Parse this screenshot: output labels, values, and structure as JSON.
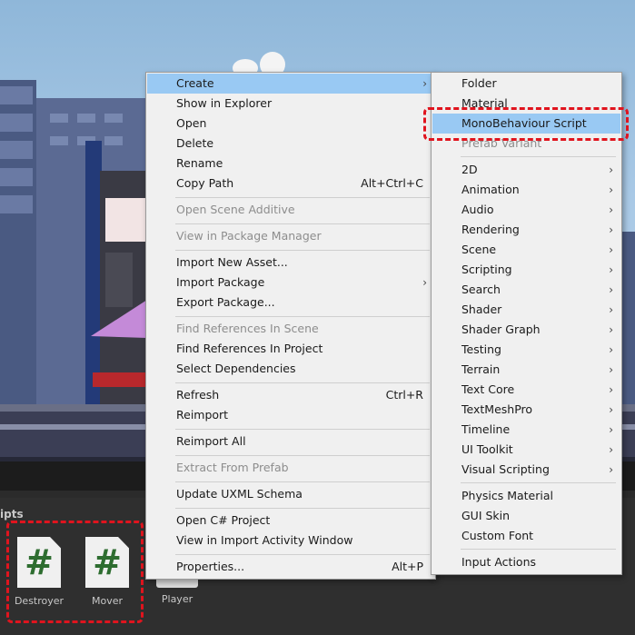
{
  "context_menu": {
    "items": [
      {
        "label": "Create",
        "shortcut": "",
        "submenu": true,
        "disabled": false,
        "highlighted": true
      },
      {
        "label": "Show in Explorer",
        "shortcut": "",
        "submenu": false,
        "disabled": false
      },
      {
        "label": "Open",
        "shortcut": "",
        "submenu": false,
        "disabled": false
      },
      {
        "label": "Delete",
        "shortcut": "",
        "submenu": false,
        "disabled": false
      },
      {
        "label": "Rename",
        "shortcut": "",
        "submenu": false,
        "disabled": false
      },
      {
        "label": "Copy Path",
        "shortcut": "Alt+Ctrl+C",
        "submenu": false,
        "disabled": false
      },
      {
        "label": "Open Scene Additive",
        "shortcut": "",
        "submenu": false,
        "disabled": true
      },
      {
        "label": "View in Package Manager",
        "shortcut": "",
        "submenu": false,
        "disabled": true
      },
      {
        "label": "Import New Asset...",
        "shortcut": "",
        "submenu": false,
        "disabled": false
      },
      {
        "label": "Import Package",
        "shortcut": "",
        "submenu": true,
        "disabled": false
      },
      {
        "label": "Export Package...",
        "shortcut": "",
        "submenu": false,
        "disabled": false
      },
      {
        "label": "Find References In Scene",
        "shortcut": "",
        "submenu": false,
        "disabled": true
      },
      {
        "label": "Find References In Project",
        "shortcut": "",
        "submenu": false,
        "disabled": false
      },
      {
        "label": "Select Dependencies",
        "shortcut": "",
        "submenu": false,
        "disabled": false
      },
      {
        "label": "Refresh",
        "shortcut": "Ctrl+R",
        "submenu": false,
        "disabled": false
      },
      {
        "label": "Reimport",
        "shortcut": "",
        "submenu": false,
        "disabled": false
      },
      {
        "label": "Reimport All",
        "shortcut": "",
        "submenu": false,
        "disabled": false
      },
      {
        "label": "Extract From Prefab",
        "shortcut": "",
        "submenu": false,
        "disabled": true
      },
      {
        "label": "Update UXML Schema",
        "shortcut": "",
        "submenu": false,
        "disabled": false
      },
      {
        "label": "Open C# Project",
        "shortcut": "",
        "submenu": false,
        "disabled": false
      },
      {
        "label": "View in Import Activity Window",
        "shortcut": "",
        "submenu": false,
        "disabled": false
      },
      {
        "label": "Properties...",
        "shortcut": "Alt+P",
        "submenu": false,
        "disabled": false
      }
    ]
  },
  "create_submenu": {
    "items": [
      {
        "label": "Folder",
        "submenu": false,
        "disabled": false
      },
      {
        "label": "Material",
        "submenu": false,
        "disabled": false
      },
      {
        "label": "MonoBehaviour Script",
        "submenu": false,
        "disabled": false,
        "highlighted": true
      },
      {
        "label": "Prefab Variant",
        "submenu": false,
        "disabled": true
      },
      {
        "label": "2D",
        "submenu": true
      },
      {
        "label": "Animation",
        "submenu": true
      },
      {
        "label": "Audio",
        "submenu": true
      },
      {
        "label": "Rendering",
        "submenu": true
      },
      {
        "label": "Scene",
        "submenu": true
      },
      {
        "label": "Scripting",
        "submenu": true
      },
      {
        "label": "Search",
        "submenu": true
      },
      {
        "label": "Shader",
        "submenu": true
      },
      {
        "label": "Shader Graph",
        "submenu": true
      },
      {
        "label": "Testing",
        "submenu": true
      },
      {
        "label": "Terrain",
        "submenu": true
      },
      {
        "label": "Text Core",
        "submenu": true
      },
      {
        "label": "TextMeshPro",
        "submenu": true
      },
      {
        "label": "Timeline",
        "submenu": true
      },
      {
        "label": "UI Toolkit",
        "submenu": true
      },
      {
        "label": "Visual Scripting",
        "submenu": true
      },
      {
        "label": "Physics Material",
        "submenu": false
      },
      {
        "label": "GUI Skin",
        "submenu": false
      },
      {
        "label": "Custom Font",
        "submenu": false
      },
      {
        "label": "Input Actions",
        "submenu": false
      }
    ]
  },
  "project_panel": {
    "folder_label": "ipts",
    "assets": [
      {
        "name": "Destroyer",
        "icon": "csharp-script-icon",
        "glyph": "#"
      },
      {
        "name": "Mover",
        "icon": "csharp-script-icon",
        "glyph": "#"
      },
      {
        "name": "Player",
        "icon": "prefab-icon",
        "glyph": ""
      }
    ]
  },
  "colors": {
    "highlight": "#99c9f3",
    "annotation": "#e0141e",
    "script_glyph": "#2e6d30"
  }
}
